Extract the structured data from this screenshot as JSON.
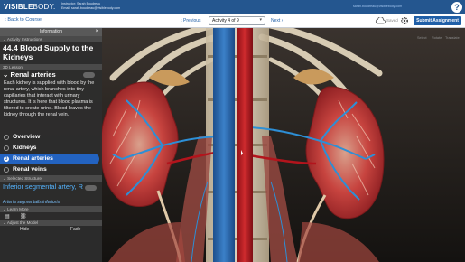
{
  "brand": {
    "name_bold": "VISIBLE",
    "name_rest": "BODY",
    "suffix": "."
  },
  "user": {
    "instructor_line": "Instructor: Sarah Boudreau",
    "email_line": "Email: sarah.boudreau@visiblebody.com",
    "email_link": "sarah.boudreau@visiblebody.com"
  },
  "help": {
    "label": "?"
  },
  "nav": {
    "back_label": "‹ Back to Course",
    "prev_label": "‹ Previous",
    "activity_selected": "Activity 4 of 9",
    "next_label": "Next ›",
    "saved_label": "Saved",
    "submit_label": "Submit Assignment"
  },
  "panel": {
    "header": "Information",
    "close": "×",
    "activity_instructions_label": "⌄ Activity Instructions",
    "title": "44.4 Blood Supply to the Kidneys",
    "lesson_label": "3D Lesson",
    "section_title": "⌄ Renal arteries",
    "body": "Each kidney is supplied with blood by the renal artery, which branches into tiny capillaries that interact with urinary structures. It is here that blood plasma is filtered to create urine. Blood leaves the kidney through the renal vein.",
    "steps": [
      "Overview",
      "Kidneys",
      "Renal arteries",
      "Renal veins"
    ],
    "active_step": 2,
    "active_mark": "3",
    "selected_structure_label": "⌄ Selected Structure",
    "structure_name": "Inferior segmental artery, R",
    "structure_latin": "Arteria segmentalis inferioris",
    "learn_more_label": "⌄ Learn More",
    "adjust_label": "⌄ Adjust the Model",
    "hide_label": "Hide",
    "fade_label": "Fade"
  },
  "viewtools": [
    "Select",
    "Rotate",
    "Translate"
  ],
  "colors": {
    "topbar": "#24568f",
    "accent": "#2363c1",
    "structure": "#55b4ff",
    "vein": "#2f6db5",
    "artery": "#b3141c"
  }
}
